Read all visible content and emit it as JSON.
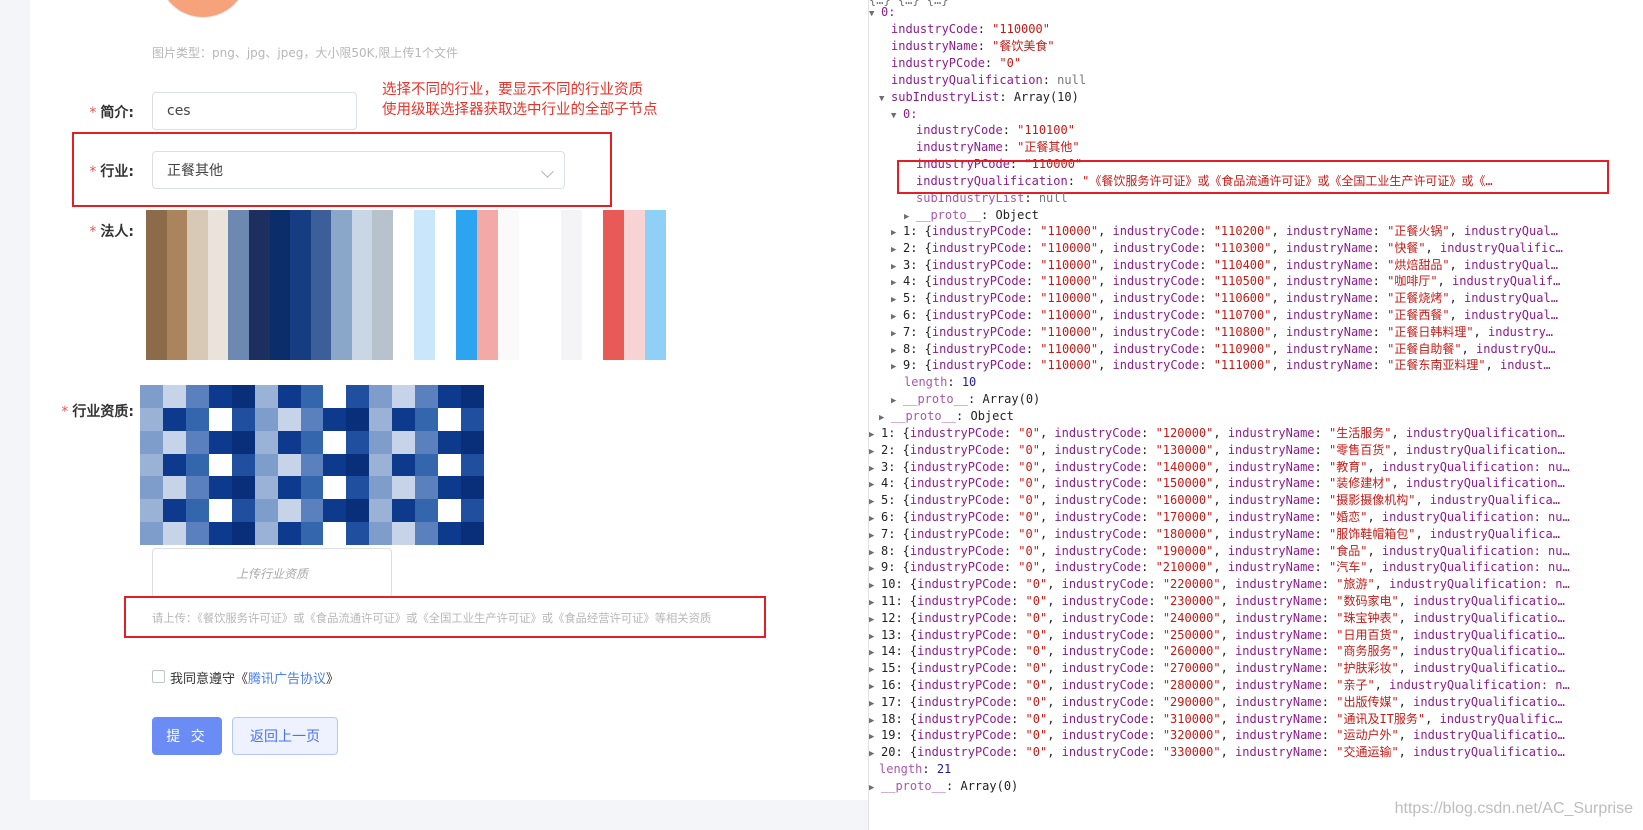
{
  "form": {
    "image_hint": "图片类型：png、jpg、jpeg，大小限50K,限上传1个文件",
    "intro_label": "简介:",
    "intro_value": "ces",
    "industry_label": "行业:",
    "industry_value": "正餐其他",
    "legal_label": "法人:",
    "qual_label": "行业资质:",
    "upload_label": "上传行业资质",
    "upload_hint": "请上传：《餐饮服务许可证》或《食品流通许可证》或《全国工业生产许可证》或《食品经营许可证》等相关资质",
    "agree_prefix": "我同意遵守《",
    "agree_link": "腾讯广告协议",
    "agree_suffix": "》",
    "submit_label": "提 交",
    "back_label": "返回上一页",
    "required_mark": "*"
  },
  "annotation": {
    "line1": "选择不同的行业，要显示不同的行业资质",
    "line2": "使用级联选择器获取选中行业的全部子节点"
  },
  "console": {
    "item0": {
      "index": "0:",
      "industryCode": "\"110000\"",
      "industryName": "\"餐饮美食\"",
      "industryPCode": "\"0\"",
      "industryQualification": "null",
      "subIndustryList": "Array(10)"
    },
    "sub0": {
      "index": "0:",
      "industryCode": "\"110100\"",
      "industryName": "\"正餐其他\"",
      "industryPCode": "\"110000\"",
      "industryQualification": "\"《餐饮服务许可证》或《食品流通许可证》或《全国工业生产许可证》或《…",
      "subIndustryList": "null",
      "proto": "Object"
    },
    "sub_rows": [
      {
        "idx": "1:",
        "pcode": "\"110000\"",
        "code": "\"110200\"",
        "name": "\"正餐火锅\"",
        "tail": "industryQual…"
      },
      {
        "idx": "2:",
        "pcode": "\"110000\"",
        "code": "\"110300\"",
        "name": "\"快餐\"",
        "tail": "industryQualific…"
      },
      {
        "idx": "3:",
        "pcode": "\"110000\"",
        "code": "\"110400\"",
        "name": "\"烘焙甜品\"",
        "tail": "industryQual…"
      },
      {
        "idx": "4:",
        "pcode": "\"110000\"",
        "code": "\"110500\"",
        "name": "\"咖啡厅\"",
        "tail": "industryQualif…"
      },
      {
        "idx": "5:",
        "pcode": "\"110000\"",
        "code": "\"110600\"",
        "name": "\"正餐烧烤\"",
        "tail": "industryQual…"
      },
      {
        "idx": "6:",
        "pcode": "\"110000\"",
        "code": "\"110700\"",
        "name": "\"正餐西餐\"",
        "tail": "industryQual…"
      },
      {
        "idx": "7:",
        "pcode": "\"110000\"",
        "code": "\"110800\"",
        "name": "\"正餐日韩料理\"",
        "tail": "industry…"
      },
      {
        "idx": "8:",
        "pcode": "\"110000\"",
        "code": "\"110900\"",
        "name": "\"正餐自助餐\"",
        "tail": "industryQu…"
      },
      {
        "idx": "9:",
        "pcode": "\"110000\"",
        "code": "\"111000\"",
        "name": "\"正餐东南亚料理\"",
        "tail": "indust…"
      }
    ],
    "sub_length": "10",
    "sub_proto": "Array(0)",
    "item0_proto": "Object",
    "top_rows": [
      {
        "idx": "1:",
        "code": "\"120000\"",
        "name": "\"生活服务\"",
        "tail": "industryQualification…"
      },
      {
        "idx": "2:",
        "code": "\"130000\"",
        "name": "\"零售百货\"",
        "tail": "industryQualification…"
      },
      {
        "idx": "3:",
        "code": "\"140000\"",
        "name": "\"教育\"",
        "tail": "industryQualification: nu…"
      },
      {
        "idx": "4:",
        "code": "\"150000\"",
        "name": "\"装修建材\"",
        "tail": "industryQualification…"
      },
      {
        "idx": "5:",
        "code": "\"160000\"",
        "name": "\"摄影摄像机构\"",
        "tail": "industryQualifica…"
      },
      {
        "idx": "6:",
        "code": "\"170000\"",
        "name": "\"婚恋\"",
        "tail": "industryQualification: nu…"
      },
      {
        "idx": "7:",
        "code": "\"180000\"",
        "name": "\"服饰鞋帽箱包\"",
        "tail": "industryQualifica…"
      },
      {
        "idx": "8:",
        "code": "\"190000\"",
        "name": "\"食品\"",
        "tail": "industryQualification: nu…"
      },
      {
        "idx": "9:",
        "code": "\"210000\"",
        "name": "\"汽车\"",
        "tail": "industryQualification: nu…"
      },
      {
        "idx": "10:",
        "code": "\"220000\"",
        "name": "\"旅游\"",
        "tail": "industryQualification: n…"
      },
      {
        "idx": "11:",
        "code": "\"230000\"",
        "name": "\"数码家电\"",
        "tail": "industryQualificatio…"
      },
      {
        "idx": "12:",
        "code": "\"240000\"",
        "name": "\"珠宝钟表\"",
        "tail": "industryQualificatio…"
      },
      {
        "idx": "13:",
        "code": "\"250000\"",
        "name": "\"日用百货\"",
        "tail": "industryQualificatio…"
      },
      {
        "idx": "14:",
        "code": "\"260000\"",
        "name": "\"商务服务\"",
        "tail": "industryQualificatio…"
      },
      {
        "idx": "15:",
        "code": "\"270000\"",
        "name": "\"护肤彩妆\"",
        "tail": "industryQualificatio…"
      },
      {
        "idx": "16:",
        "code": "\"280000\"",
        "name": "\"亲子\"",
        "tail": "industryQualification: n…"
      },
      {
        "idx": "17:",
        "code": "\"290000\"",
        "name": "\"出版传媒\"",
        "tail": "industryQualificatio…"
      },
      {
        "idx": "18:",
        "code": "\"310000\"",
        "name": "\"通讯及IT服务\"",
        "tail": "industryQualific…"
      },
      {
        "idx": "19:",
        "code": "\"320000\"",
        "name": "\"运动户外\"",
        "tail": "industryQualificatio…"
      },
      {
        "idx": "20:",
        "code": "\"330000\"",
        "name": "\"交通运输\"",
        "tail": "industryQualificatio…"
      }
    ],
    "length": "21",
    "proto": "Array(0)"
  },
  "watermark": "https://blog.csdn.net/AC_Surprise",
  "colors": {
    "required": "#f05050",
    "annotation": "#e8332a",
    "redbox": "#e31e24",
    "primary": "#6b8cf5",
    "link": "#4a7ff0"
  }
}
